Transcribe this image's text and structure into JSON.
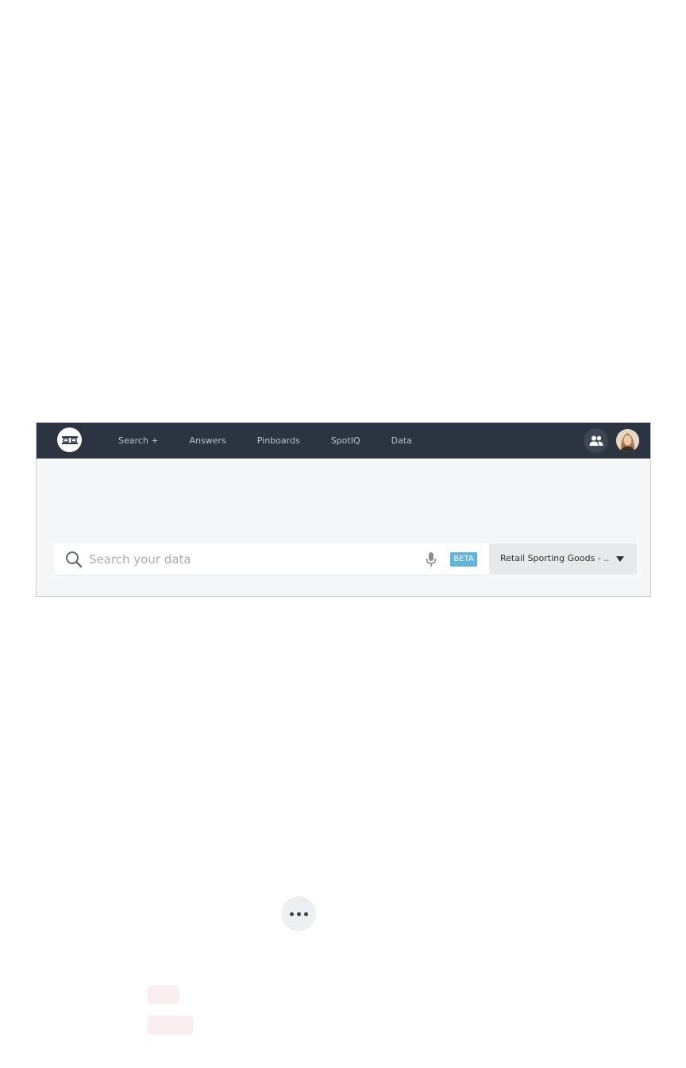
{
  "nav": {
    "items": [
      {
        "label": "Search +"
      },
      {
        "label": "Answers"
      },
      {
        "label": "Pinboards"
      },
      {
        "label": "SpotIQ"
      },
      {
        "label": "Data"
      }
    ]
  },
  "search": {
    "placeholder": "Search your data",
    "value": "",
    "beta_label": "BETA"
  },
  "source": {
    "selected": "Retail Sporting Goods - ..."
  },
  "colors": {
    "topbar": "#2b3440",
    "beta_badge": "#62b4e0"
  },
  "icons": [
    "thoughtspot-logo-icon",
    "people-icon",
    "user-avatar",
    "search-icon",
    "microphone-icon",
    "chevron-down-icon",
    "more-dots-icon"
  ]
}
